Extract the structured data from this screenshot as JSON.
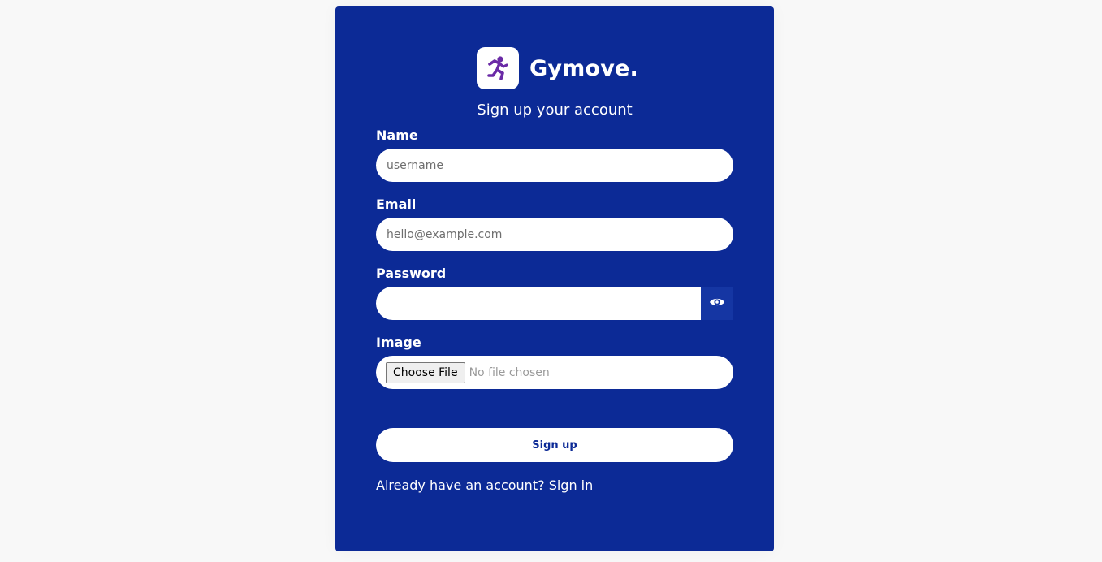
{
  "brand": {
    "name": "Gymove.",
    "icon": "running-person-icon",
    "accent_color": "#0c2a96",
    "icon_color": "#6a2aa6"
  },
  "form": {
    "heading": "Sign up your account",
    "name": {
      "label": "Name",
      "placeholder": "username",
      "value": ""
    },
    "email": {
      "label": "Email",
      "placeholder": "hello@example.com",
      "value": ""
    },
    "password": {
      "label": "Password",
      "value": "",
      "toggle_icon": "eye-icon"
    },
    "image": {
      "label": "Image",
      "button_label": "Choose File",
      "status": "No file chosen"
    },
    "submit_label": "Sign up"
  },
  "footer": {
    "text": "Already have an account?",
    "link_label": "Sign in"
  }
}
